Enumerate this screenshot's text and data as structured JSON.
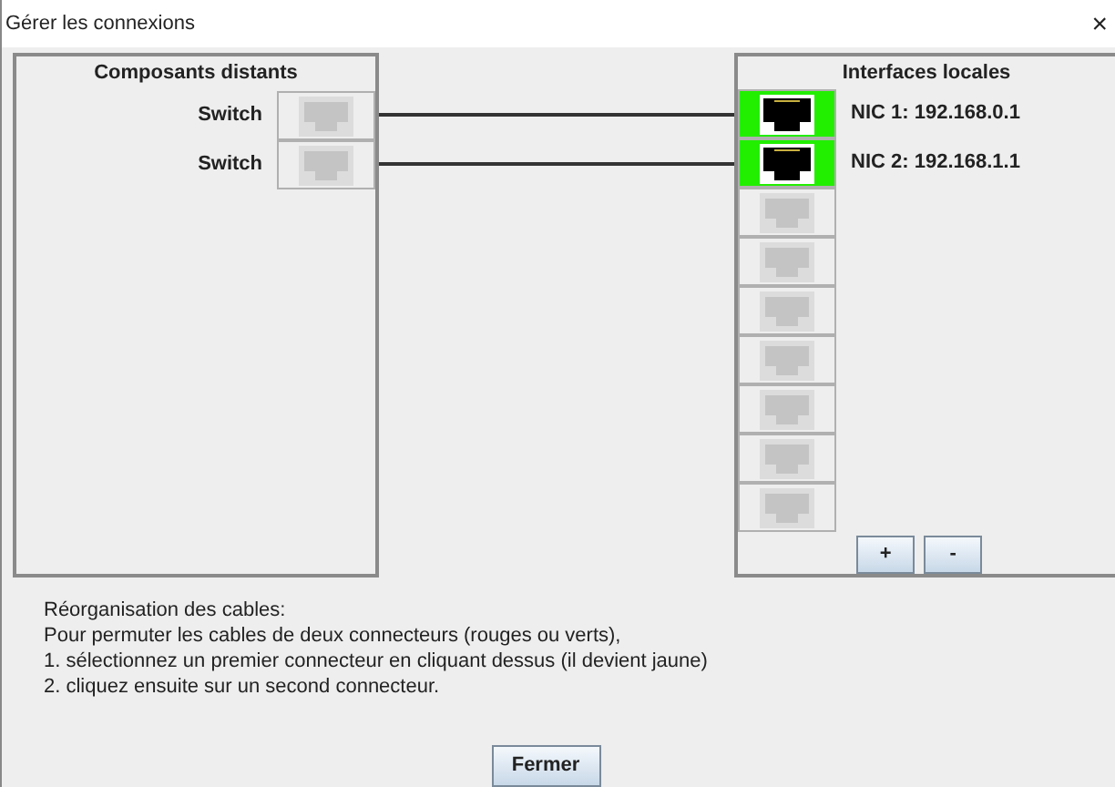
{
  "window": {
    "title": "Gérer les connexions",
    "close": "×"
  },
  "remote": {
    "title": "Composants distants",
    "components": [
      {
        "label": "Switch"
      },
      {
        "label": "Switch"
      }
    ]
  },
  "local": {
    "title": "Interfaces locales",
    "interfaces": [
      {
        "label": "NIC 1: 192.168.0.1",
        "connected": true
      },
      {
        "label": "NIC 2: 192.168.1.1",
        "connected": true
      },
      {
        "connected": false
      },
      {
        "connected": false
      },
      {
        "connected": false
      },
      {
        "connected": false
      },
      {
        "connected": false
      },
      {
        "connected": false
      },
      {
        "connected": false
      }
    ],
    "buttons": [
      "+",
      "-"
    ]
  },
  "help": [
    "Réorganisation des cables:",
    "Pour permuter les cables de deux connecteurs (rouges ou verts),",
    "1. sélectionnez un premier connecteur en cliquant dessus (il devient jaune)",
    "2. cliquez ensuite sur un second connecteur."
  ],
  "close_button": "Fermer"
}
